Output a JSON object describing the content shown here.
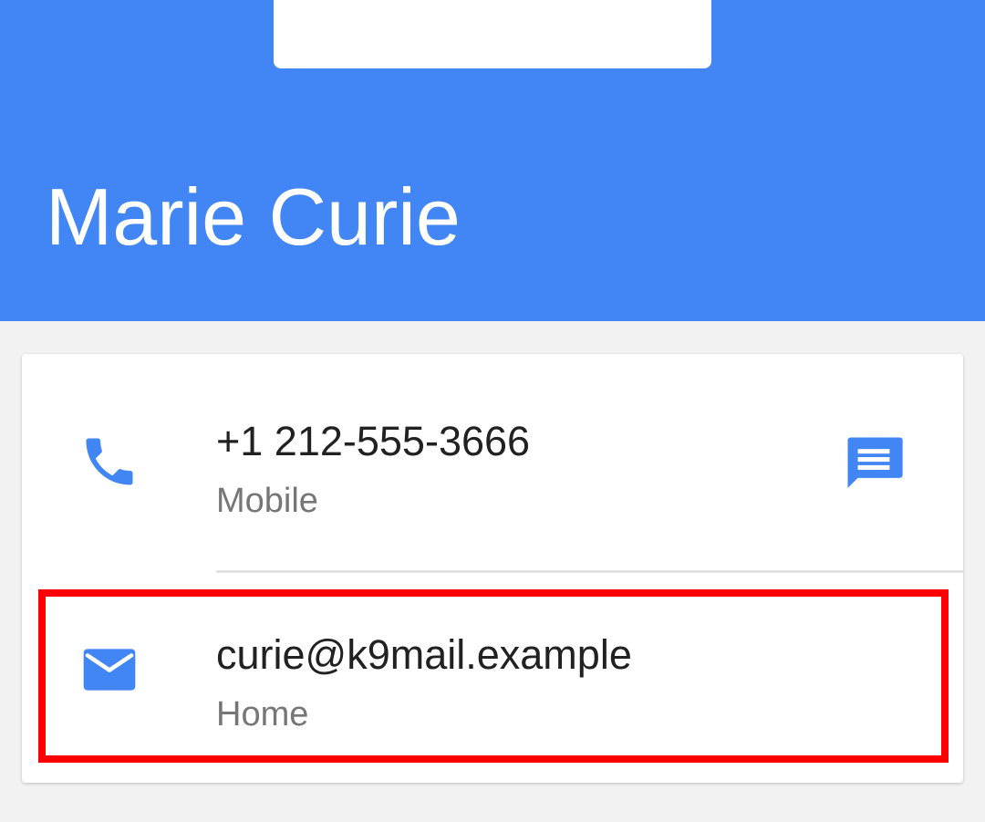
{
  "contact": {
    "name": "Marie Curie"
  },
  "phone": {
    "number": "+1 212-555-3666",
    "type": "Mobile",
    "icon": "phone-icon",
    "action_icon": "message-icon"
  },
  "email": {
    "address": "curie@k9mail.example",
    "type": "Home",
    "icon": "email-icon"
  },
  "colors": {
    "header": "#4286f5",
    "accent": "#4286f5",
    "highlight": "#ff0000",
    "background": "#f2f2f2"
  }
}
